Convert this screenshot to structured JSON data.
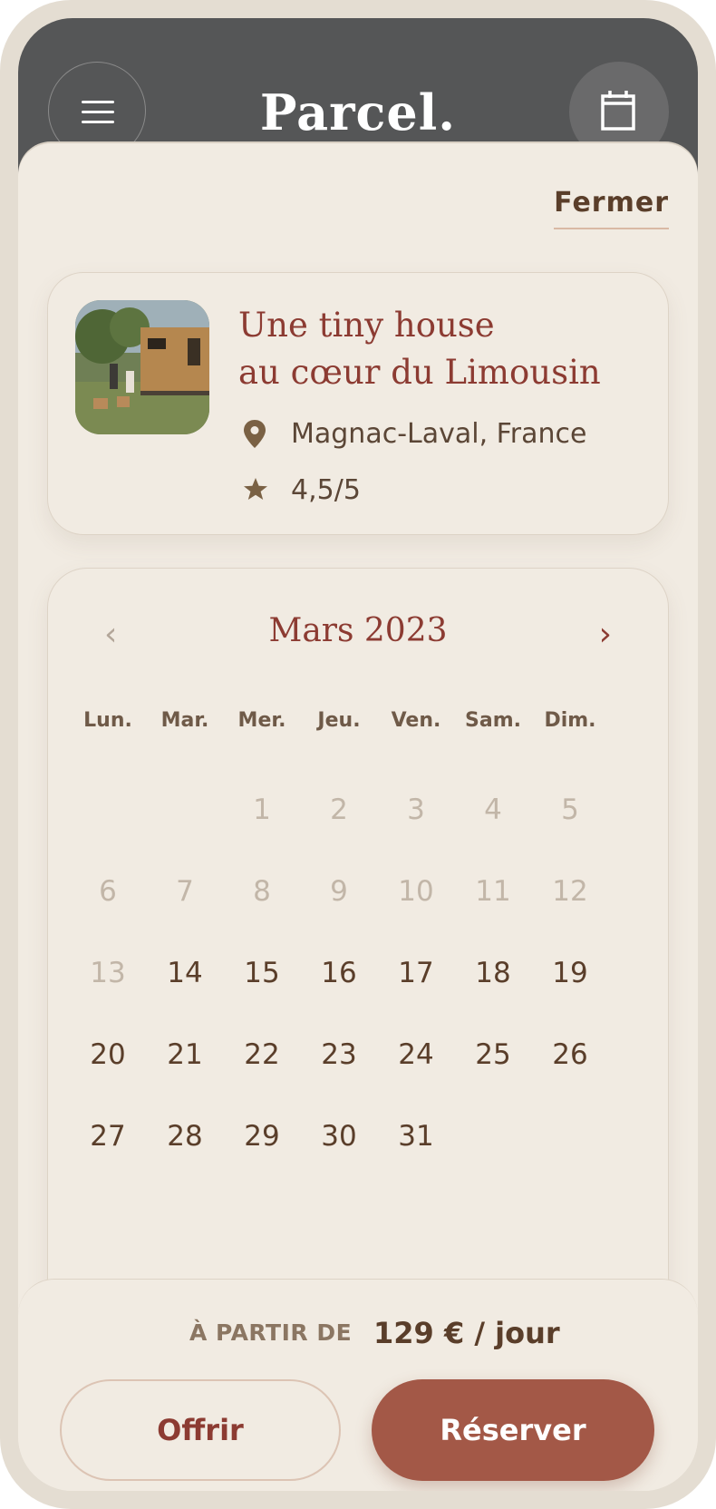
{
  "app": {
    "logo": "Parcel."
  },
  "header": {
    "close_label": "Fermer"
  },
  "listing": {
    "title_line1": "Une tiny house",
    "title_line2": "au cœur du Limousin",
    "location": "Magnac-Laval, France",
    "rating": "4,5/5"
  },
  "calendar": {
    "month_label": "Mars 2023",
    "prev": "‹",
    "next": "›",
    "weekdays": [
      "Lun.",
      "Mar.",
      "Mer.",
      "Jeu.",
      "Ven.",
      "Sam.",
      "Dim."
    ],
    "days": [
      {
        "n": "1",
        "past": true
      },
      {
        "n": "2",
        "past": true
      },
      {
        "n": "3",
        "past": true
      },
      {
        "n": "4",
        "past": true
      },
      {
        "n": "5",
        "past": true
      },
      {
        "n": "6",
        "past": true
      },
      {
        "n": "7",
        "past": true
      },
      {
        "n": "8",
        "past": true
      },
      {
        "n": "9",
        "past": true
      },
      {
        "n": "10",
        "past": true
      },
      {
        "n": "11",
        "past": true
      },
      {
        "n": "12",
        "past": true
      },
      {
        "n": "13",
        "past": true
      },
      {
        "n": "14",
        "past": false
      },
      {
        "n": "15",
        "past": false
      },
      {
        "n": "16",
        "past": false
      },
      {
        "n": "17",
        "past": false
      },
      {
        "n": "18",
        "past": false
      },
      {
        "n": "19",
        "past": false
      },
      {
        "n": "20",
        "past": false
      },
      {
        "n": "21",
        "past": false
      },
      {
        "n": "22",
        "past": false
      },
      {
        "n": "23",
        "past": false
      },
      {
        "n": "24",
        "past": false
      },
      {
        "n": "25",
        "past": false
      },
      {
        "n": "26",
        "past": false
      },
      {
        "n": "27",
        "past": false
      },
      {
        "n": "28",
        "past": false
      },
      {
        "n": "29",
        "past": false
      },
      {
        "n": "30",
        "past": false
      },
      {
        "n": "31",
        "past": false
      }
    ]
  },
  "footer": {
    "from_label": "À PARTIR DE",
    "price": "129 € / jour",
    "offer_label": "Offrir",
    "book_label": "Réserver"
  },
  "colors": {
    "accent": "#a35847",
    "title": "#8c3b32",
    "header_bg": "#555657",
    "surface": "#f1ebe2",
    "frame": "#e4ddd2"
  }
}
